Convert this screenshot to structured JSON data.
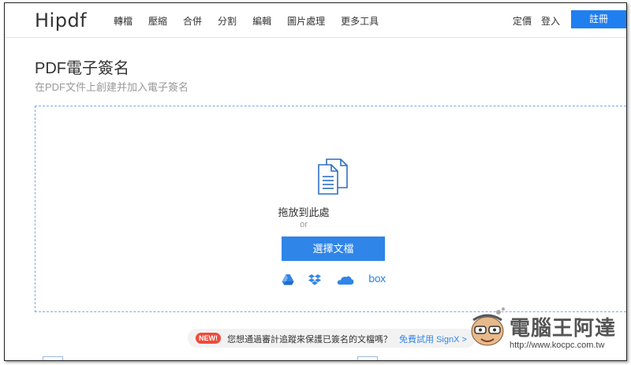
{
  "header": {
    "logo": "Hipdf",
    "nav": [
      "轉檔",
      "壓縮",
      "合併",
      "分割",
      "編輯",
      "圖片處理",
      "更多工具"
    ],
    "pricing": "定價",
    "login": "登入",
    "signup": "註冊"
  },
  "main": {
    "title": "PDF電子簽名",
    "subtitle": "在PDF文件上創建并加入電子簽名"
  },
  "dropzone": {
    "drop_text": "拖放到此處",
    "or_text": "or",
    "choose_label": "選擇文檔",
    "cloud_services": [
      "google-drive-icon",
      "dropbox-icon",
      "onedrive-icon",
      "box-icon"
    ],
    "box_label": "box"
  },
  "promo": {
    "badge": "NEW!",
    "text": "您想通過審計追蹤來保護已簽名的文檔嗎？",
    "link": "免費試用 SignX >"
  },
  "watermark": {
    "title": "電腦王阿達",
    "url": "http://www.kocpc.com.tw"
  },
  "colors": {
    "accent": "#2f85e8",
    "badge": "#f04a3a"
  }
}
